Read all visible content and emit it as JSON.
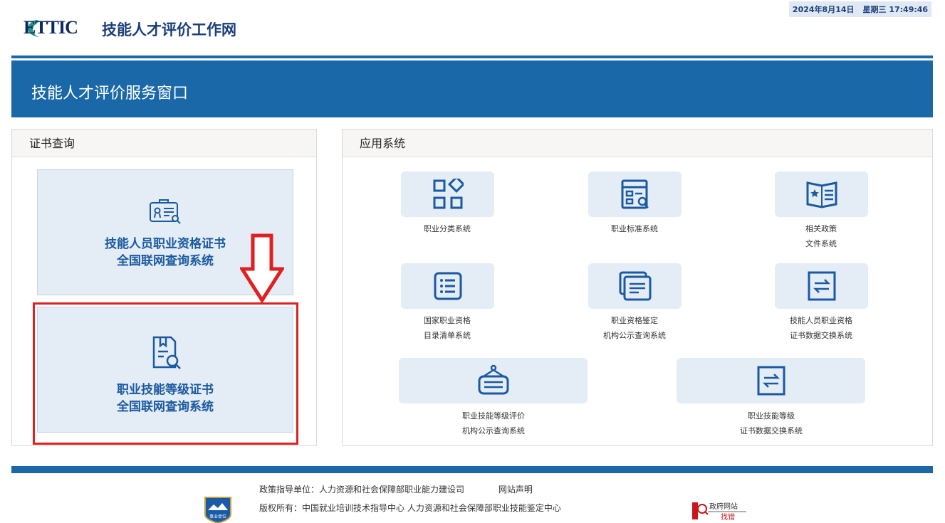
{
  "header": {
    "logo_text": "ETTIC",
    "site_title": "技能人才评价工作网",
    "date": "2024年8月14日",
    "weekday": "星期三",
    "time": "17:49:46"
  },
  "banner": {
    "title": "技能人才评价服务窗口"
  },
  "cert_panel": {
    "title": "证书查询",
    "cards": [
      {
        "line1": "技能人员职业资格证书",
        "line2": "全国联网查询系统",
        "icon": "certificate-search-icon"
      },
      {
        "line1": "职业技能等级证书",
        "line2": "全国联网查询系统",
        "icon": "document-search-icon"
      }
    ]
  },
  "app_panel": {
    "title": "应用系统",
    "apps": [
      {
        "line1": "职业分类系统",
        "line2": "",
        "icon": "grid-icon"
      },
      {
        "line1": "职业标准系统",
        "line2": "",
        "icon": "standard-search-icon"
      },
      {
        "line1": "相关政策",
        "line2": "文件系统",
        "icon": "policy-book-icon"
      },
      {
        "line1": "国家职业资格",
        "line2": "目录清单系统",
        "icon": "list-icon"
      },
      {
        "line1": "职业资格鉴定",
        "line2": "机构公示查询系统",
        "icon": "documents-icon"
      },
      {
        "line1": "技能人员职业资格",
        "line2": "证书数据交换系统",
        "icon": "exchange-icon"
      },
      {
        "line1": "职业技能等级评价",
        "line2": "机构公示查询系统",
        "icon": "notice-sign-icon"
      },
      {
        "line1": "职业技能等级",
        "line2": "证书数据交换系统",
        "icon": "exchange-icon"
      }
    ]
  },
  "footer": {
    "guide_unit": "政策指导单位：人力资源和社会保障部职业能力建设司",
    "statement": "网站声明",
    "copyright": "版权所有：中国就业培训技术指导中心 人力资源和社会保障部职业技能鉴定中心",
    "emblem_text": "事业单位",
    "gov_badge": "政府网站",
    "gov_badge_sub": "找错"
  },
  "colors": {
    "primary": "#1a68a8",
    "tile_bg": "#e4ecf6",
    "highlight": "#e02020"
  }
}
